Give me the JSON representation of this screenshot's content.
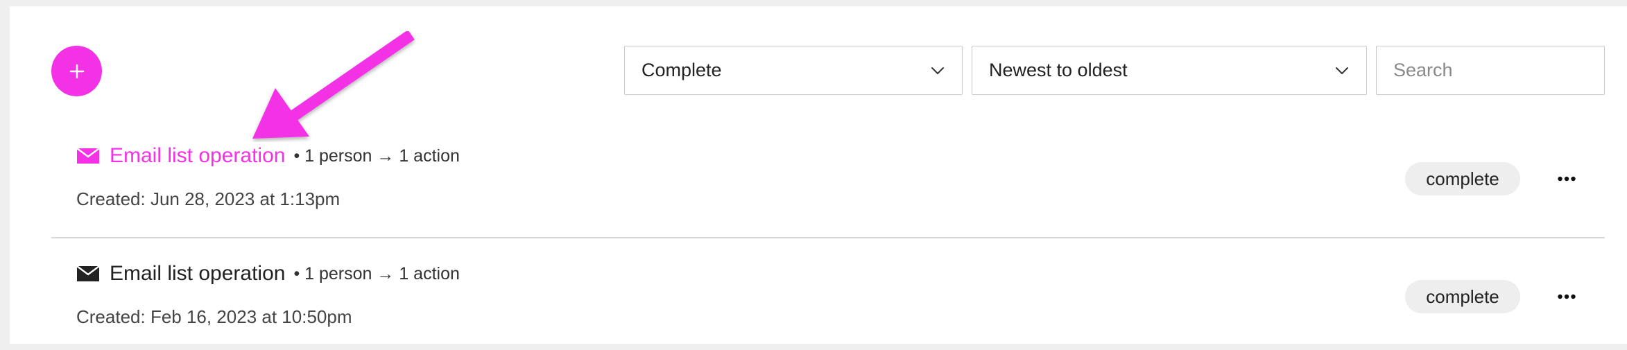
{
  "toolbar": {
    "add_icon": "plus-icon",
    "status_filter": "Complete",
    "sort_order": "Newest to oldest",
    "search_placeholder": "Search",
    "chevron_icon": "chevron-down-icon"
  },
  "items": [
    {
      "icon": "mail-icon",
      "title": "Email list operation",
      "meta": "• 1 person → 1 action",
      "created": "Created: Jun 28, 2023 at 1:13pm",
      "status": "complete",
      "highlighted": true
    },
    {
      "icon": "mail-icon",
      "title": "Email list operation",
      "meta": "• 1 person → 1 action",
      "created": "Created: Feb 16, 2023 at 10:50pm",
      "status": "complete",
      "highlighted": false
    }
  ],
  "colors": {
    "accent": "#f332e6",
    "badge_bg": "#eeeeee",
    "page_bg": "#efefef"
  }
}
